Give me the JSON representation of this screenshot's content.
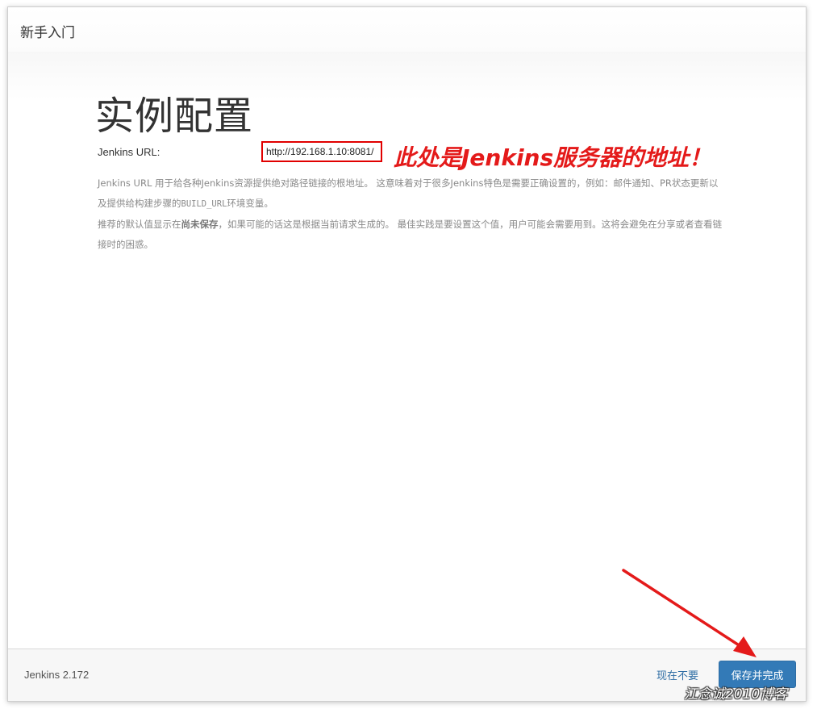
{
  "header": {
    "title": "新手入门"
  },
  "main": {
    "page_title": "实例配置",
    "url_label": "Jenkins URL:",
    "url_value": "http://192.168.1.10:8081/",
    "help": {
      "p1": "Jenkins URL 用于给各种Jenkins资源提供绝对路径链接的根地址。 这意味着对于很多Jenkins特色是需要正确设置的，例如：邮件通知、PR状态更新以及提供给构建步骤的",
      "p1_code": "BUILD_URL",
      "p1_end": "环境变量。",
      "p2_start": "推荐的默认值显示在",
      "p2_bold": "尚未保存",
      "p2_end": "，如果可能的话这是根据当前请求生成的。 最佳实践是要设置这个值，用户可能会需要用到。这将会避免在分享或者查看链接时的困惑。"
    }
  },
  "annotation": {
    "text": "此处是Jenkins服务器的地址！",
    "color": "#e41a1a"
  },
  "footer": {
    "version": "Jenkins 2.172",
    "skip_label": "现在不要",
    "save_label": "保存并完成"
  },
  "watermark": {
    "text": "江念诚2010博客"
  },
  "colors": {
    "primary": "#337ab7",
    "annotation_red": "#e10000"
  }
}
